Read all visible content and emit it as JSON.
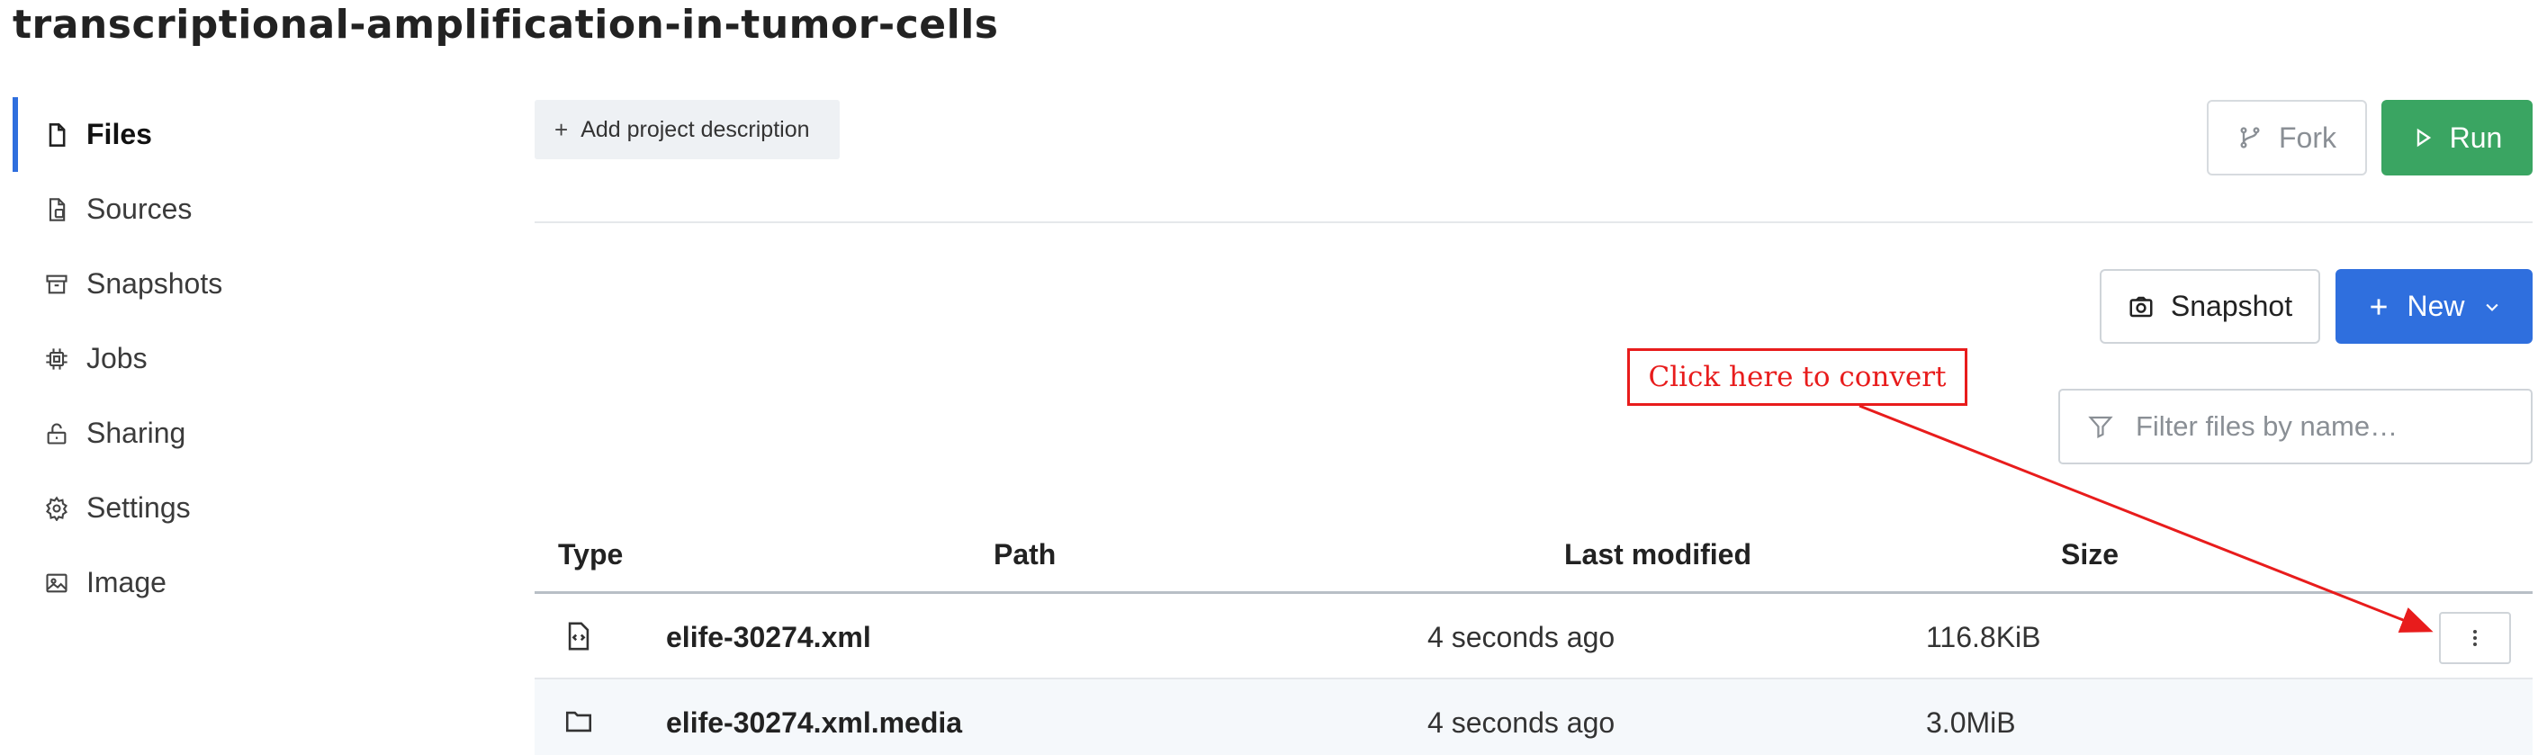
{
  "page": {
    "title": "transcriptional-amplification-in-tumor-cells"
  },
  "sidebar": {
    "items": [
      {
        "label": "Files",
        "icon": "file-icon",
        "active": true
      },
      {
        "label": "Sources",
        "icon": "source-file-icon",
        "active": false
      },
      {
        "label": "Snapshots",
        "icon": "archive-icon",
        "active": false
      },
      {
        "label": "Jobs",
        "icon": "cpu-chip-icon",
        "active": false
      },
      {
        "label": "Sharing",
        "icon": "lock-open-icon",
        "active": false
      },
      {
        "label": "Settings",
        "icon": "gear-icon",
        "active": false
      },
      {
        "label": "Image",
        "icon": "image-icon",
        "active": false
      }
    ]
  },
  "toolbar": {
    "add_description": "Add project description",
    "fork": "Fork",
    "run": "Run",
    "snapshot": "Snapshot",
    "new": "New",
    "filter_placeholder": "Filter files by name…"
  },
  "table": {
    "headers": {
      "type": "Type",
      "path": "Path",
      "last_modified": "Last modified",
      "size": "Size"
    },
    "rows": [
      {
        "type_icon": "code-file-icon",
        "path": "elife-30274.xml",
        "last_modified": "4 seconds ago",
        "size": "116.8KiB"
      },
      {
        "type_icon": "folder-icon",
        "path": "elife-30274.xml.media",
        "last_modified": "4 seconds ago",
        "size": "3.0MiB"
      }
    ]
  },
  "annotation": {
    "text": "Click here to convert"
  },
  "colors": {
    "accent": "#2f6fde",
    "run_green": "#3aa562",
    "annotation_red": "#e81c1c"
  }
}
